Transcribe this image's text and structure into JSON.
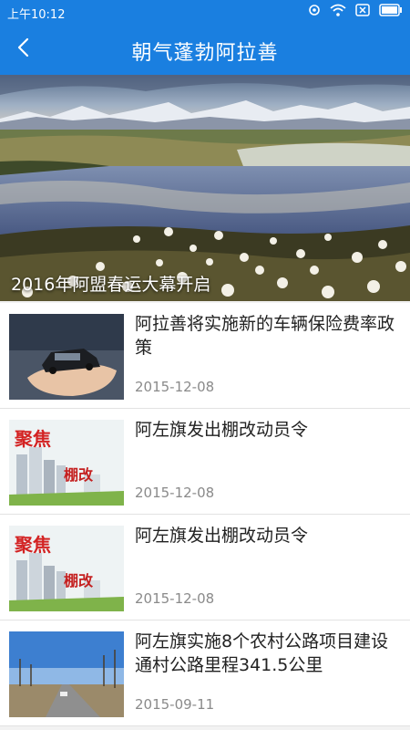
{
  "status_bar": {
    "time": "上午10:12",
    "icons": [
      "location-ring-icon",
      "wifi-icon",
      "sim-off-icon",
      "battery-icon"
    ]
  },
  "app_bar": {
    "title": "朝气蓬勃阿拉善",
    "back_icon": "chevron-left-icon",
    "color": "#1a7fe0"
  },
  "banner": {
    "caption": "2016年阿盟春运大幕开启",
    "image": "snowy-mountains-lake-cotton-grass-photo"
  },
  "news": [
    {
      "headline": "阿拉善将实施新的车辆保险费率政策",
      "date": "2015-12-08",
      "thumb": "hands-holding-car-photo"
    },
    {
      "headline": "阿左旗发出棚改动员令",
      "date": "2015-12-08",
      "thumb": "focus-shantytown-renovation-graphic"
    },
    {
      "headline": "阿左旗发出棚改动员令",
      "date": "2015-12-08",
      "thumb": "focus-shantytown-renovation-graphic"
    },
    {
      "headline": "阿左旗实施8个农村公路项目建设通村公路里程341.5公里",
      "date": "2015-09-11",
      "thumb": "rural-road-trees-photo"
    }
  ],
  "thumb_text": {
    "focus": "聚焦",
    "renovation": "棚改"
  }
}
